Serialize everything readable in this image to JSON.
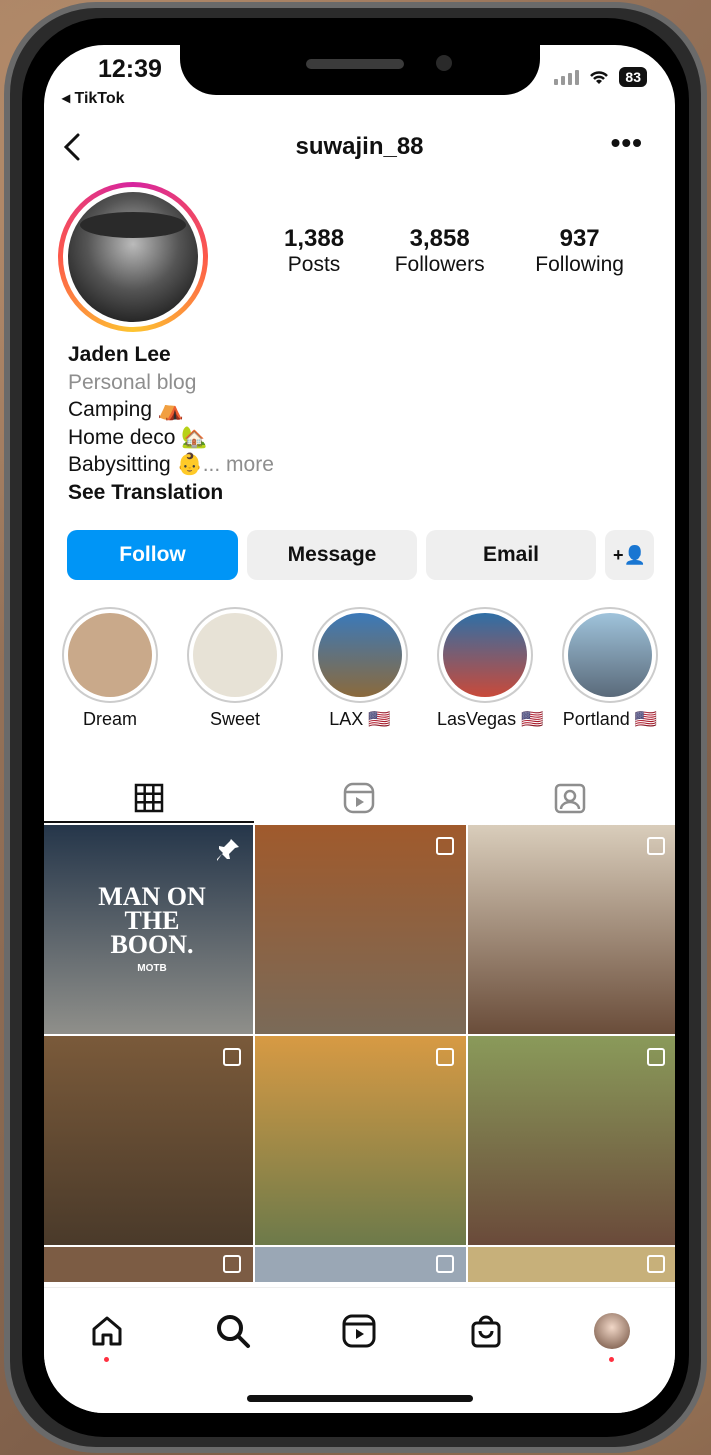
{
  "status_bar": {
    "time": "12:39",
    "back_app": "◂ TikTok",
    "battery": "83"
  },
  "header": {
    "username": "suwajin_88",
    "more": "•••"
  },
  "stats": [
    {
      "value": "1,388",
      "label": "Posts"
    },
    {
      "value": "3,858",
      "label": "Followers"
    },
    {
      "value": "937",
      "label": "Following"
    }
  ],
  "bio": {
    "name": "Jaden Lee",
    "category": "Personal blog",
    "line1": "Camping ⛺",
    "line2": "Home deco 🏡",
    "line3": "Babysitting 👶",
    "more": "... more",
    "translate": "See Translation"
  },
  "buttons": {
    "follow": "Follow",
    "message": "Message",
    "email": "Email",
    "add_user": "+👤"
  },
  "highlights": [
    {
      "label": "Dream",
      "color": "#c9a98a"
    },
    {
      "label": "Sweet",
      "color": "#e7e2d6"
    },
    {
      "label": "LAX 🇺🇸",
      "color": "#3b79b9"
    },
    {
      "label": "LasVegas 🇺🇸",
      "color": "#2f6fa6"
    },
    {
      "label": "Portland 🇺🇸",
      "color": "#6f9fbf"
    }
  ],
  "posts_overlay_title": "MAN ON THE BOON.",
  "posts_overlay_sub": "MOTB",
  "posts": [
    {
      "color": "#3c4a5c",
      "pinned": true
    },
    {
      "color": "#8b5a3a"
    },
    {
      "color": "#5a4a3a"
    },
    {
      "color": "#6a5040"
    },
    {
      "color": "#7a8a5a"
    },
    {
      "color": "#a88b5a"
    },
    {
      "color": "#7c5c44"
    },
    {
      "color": "#9aa7b5"
    },
    {
      "color": "#c7b07a"
    }
  ]
}
